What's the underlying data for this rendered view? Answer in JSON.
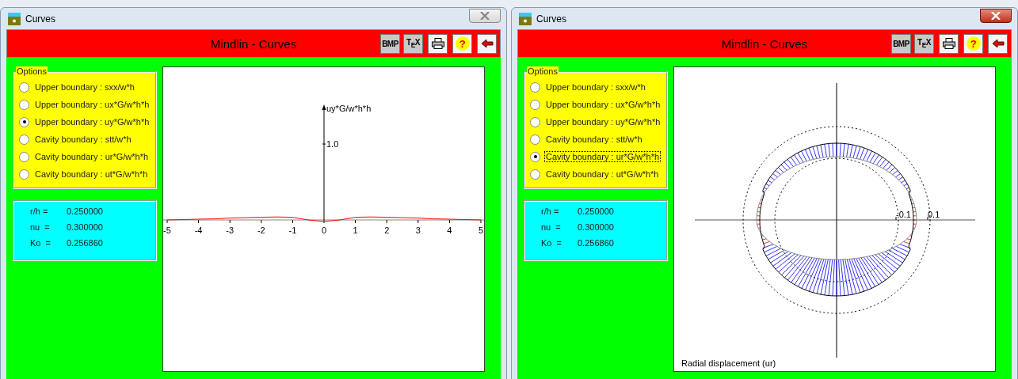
{
  "windows": [
    {
      "title": "Curves",
      "active": false,
      "header": "Mindlin - Curves",
      "toolbar": [
        {
          "kind": "text",
          "label": "BMP"
        },
        {
          "kind": "text",
          "label": "T$_{E}$X"
        },
        {
          "kind": "printer"
        },
        {
          "kind": "help",
          "glyph": "?"
        },
        {
          "kind": "back"
        }
      ],
      "options": {
        "legend": "Options",
        "items": [
          {
            "label": "Upper boundary : sxx/w*h",
            "selected": false,
            "focused": false
          },
          {
            "label": "Upper boundary : ux*G/w*h*h",
            "selected": false,
            "focused": false
          },
          {
            "label": "Upper boundary : uy*G/w*h*h",
            "selected": true,
            "focused": false
          },
          {
            "label": "Cavity boundary : stt/w*h",
            "selected": false,
            "focused": false
          },
          {
            "label": "Cavity boundary : ur*G/w*h*h",
            "selected": false,
            "focused": false
          },
          {
            "label": "Cavity boundary : ut*G/w*h*h",
            "selected": false,
            "focused": false
          }
        ]
      },
      "params": [
        {
          "label": "r/h =",
          "value": "0.250000"
        },
        {
          "label": "nu  =",
          "value": "0.300000"
        },
        {
          "label": "Ko  =",
          "value": "0.256860"
        }
      ],
      "plot": {
        "kind": "curve",
        "ylabel": "uy*G/w*h*h",
        "x_tick_labels": [
          "-5",
          "-4",
          "-3",
          "-2",
          "-1",
          "0",
          "1",
          "2",
          "3",
          "4",
          "5"
        ],
        "y_tick_labels": [
          "1.0"
        ]
      }
    },
    {
      "title": "Curves",
      "active": true,
      "header": "Mindlin - Curves",
      "toolbar": [
        {
          "kind": "text",
          "label": "BMP"
        },
        {
          "kind": "text",
          "label": "T$_{E}$X"
        },
        {
          "kind": "printer"
        },
        {
          "kind": "help",
          "glyph": "?"
        },
        {
          "kind": "back"
        }
      ],
      "options": {
        "legend": "Options",
        "items": [
          {
            "label": "Upper boundary : sxx/w*h",
            "selected": false,
            "focused": false
          },
          {
            "label": "Upper boundary : ux*G/w*h*h",
            "selected": false,
            "focused": false
          },
          {
            "label": "Upper boundary : uy*G/w*h*h",
            "selected": false,
            "focused": false
          },
          {
            "label": "Cavity boundary : stt/w*h",
            "selected": false,
            "focused": false
          },
          {
            "label": "Cavity boundary : ur*G/w*h*h",
            "selected": true,
            "focused": true
          },
          {
            "label": "Cavity boundary : ut*G/w*h*h",
            "selected": false,
            "focused": false
          }
        ]
      },
      "params": [
        {
          "label": "r/h =",
          "value": "0.250000"
        },
        {
          "label": "nu  =",
          "value": "0.300000"
        },
        {
          "label": "Ko  =",
          "value": "0.256860"
        }
      ],
      "plot": {
        "kind": "polar",
        "caption": "Radial displacement (ur)",
        "tick_labels": [
          "-0.1",
          "0.1"
        ]
      }
    }
  ]
}
